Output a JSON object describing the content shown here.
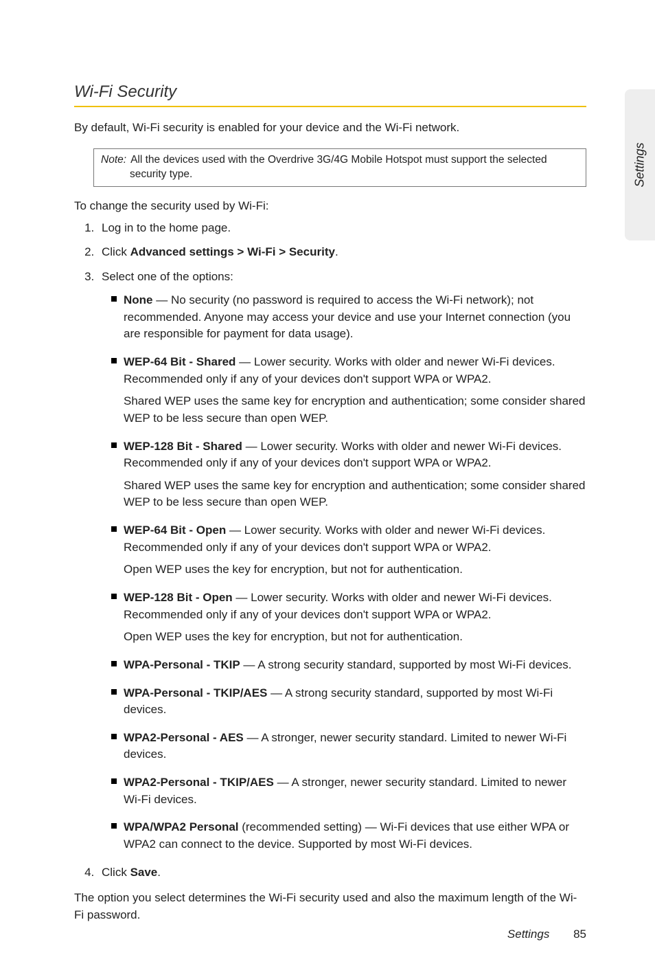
{
  "sideTab": "Settings",
  "title": "Wi-Fi Security",
  "intro": "By default, Wi-Fi security is enabled for your device and the Wi-Fi network.",
  "note": {
    "label": "Note:",
    "text": "All the devices used with the Overdrive 3G/4G Mobile Hotspot must support the selected security type."
  },
  "lead": "To change the security used by Wi-Fi:",
  "steps": {
    "s1": "Log in to the home page.",
    "s2": {
      "prefix": "Click ",
      "bold": "Advanced settings > Wi-Fi > Security",
      "suffix": "."
    },
    "s3": {
      "text": "Select one of the options:",
      "options": {
        "none": {
          "label": "None",
          "desc": " — No security (no password is required to access the Wi-Fi network); not recommended. Anyone may access your device and use your Internet connection (you are responsible for payment for data usage)."
        },
        "wep64s": {
          "label": "WEP-64 Bit - Shared",
          "desc": " — Lower security. Works with older and newer Wi-Fi devices. Recommended only if any of your devices don't support WPA or WPA2.",
          "extra": "Shared WEP uses the same key for encryption and authentication; some consider shared WEP to be less secure than open WEP."
        },
        "wep128s": {
          "label": "WEP-128 Bit - Shared",
          "desc": " — Lower security. Works with older and newer Wi-Fi devices. Recommended only if any of your devices don't support WPA or WPA2.",
          "extra": "Shared WEP uses the same key for encryption and authentication; some consider shared WEP to be less secure than open WEP."
        },
        "wep64o": {
          "label": "WEP-64 Bit - Open",
          "desc": " — Lower security. Works with older and newer Wi-Fi devices. Recommended only if any of your devices don't support WPA or WPA2.",
          "extra": "Open WEP uses the key for encryption, but not for authentication."
        },
        "wep128o": {
          "label": "WEP-128 Bit - Open",
          "desc": " — Lower security. Works with older and newer Wi-Fi devices. Recommended only if any of your devices don't support WPA or WPA2.",
          "extra": "Open WEP uses the key for encryption, but not for authentication."
        },
        "wpatk": {
          "label": "WPA-Personal - TKIP",
          "desc": " — A strong security standard, supported by most Wi-Fi devices."
        },
        "wpata": {
          "label": "WPA-Personal - TKIP/AES",
          "desc": " — A strong security standard, supported by most Wi-Fi devices."
        },
        "wpa2a": {
          "label": "WPA2-Personal - AES",
          "desc": " — A stronger, newer security standard. Limited to newer Wi-Fi devices."
        },
        "wpa2ta": {
          "label": "WPA2-Personal - TKIP/AES",
          "desc": " — A stronger, newer security standard. Limited to newer Wi-Fi devices."
        },
        "wpaw2": {
          "label": "WPA/WPA2 Personal",
          "desc": " (recommended setting) — Wi-Fi devices that use either WPA or WPA2 can connect to the device. Supported by most Wi-Fi devices."
        }
      }
    },
    "s4": {
      "prefix": "Click ",
      "bold": "Save",
      "suffix": "."
    }
  },
  "closing": "The option you select determines the Wi-Fi security used and also the maximum length of the Wi-Fi password.",
  "footer": {
    "section": "Settings",
    "page": "85"
  }
}
